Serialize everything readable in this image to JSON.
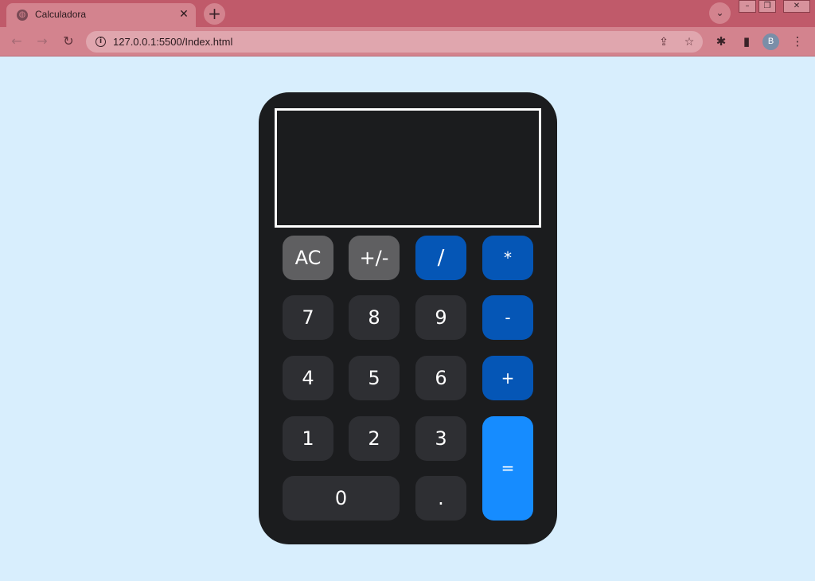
{
  "browser": {
    "tab_title": "Calculadora",
    "tab_close": "✕",
    "new_tab": "+",
    "tab_search": "⌄",
    "url": "127.0.0.1:5500/Index.html",
    "profile_initial": "B",
    "window_minimize": "–",
    "window_restore": "❐",
    "window_close": "✕",
    "back": "←",
    "forward": "→",
    "reload": "↻",
    "share": "⇪",
    "bookmark": "☆",
    "extensions": "✱",
    "sidebar": "▮",
    "menu": "⋮",
    "info": "i"
  },
  "calculator": {
    "display_value": "",
    "keys": {
      "ac": "AC",
      "sign": "+/-",
      "divide": "/",
      "multiply": "*",
      "seven": "7",
      "eight": "8",
      "nine": "9",
      "subtract": "-",
      "four": "4",
      "five": "5",
      "six": "6",
      "add": "+",
      "one": "1",
      "two": "2",
      "three": "3",
      "equals": "=",
      "zero": "0",
      "decimal": "."
    }
  },
  "colors": {
    "page_background": "#d8eefd",
    "calculator_body": "#1b1c1e",
    "number_key": "#2e2f33",
    "function_key": "#5f5f61",
    "operator_key": "#0556b6",
    "equals_key": "#168cff",
    "browser_frame": "#c05a6a"
  }
}
